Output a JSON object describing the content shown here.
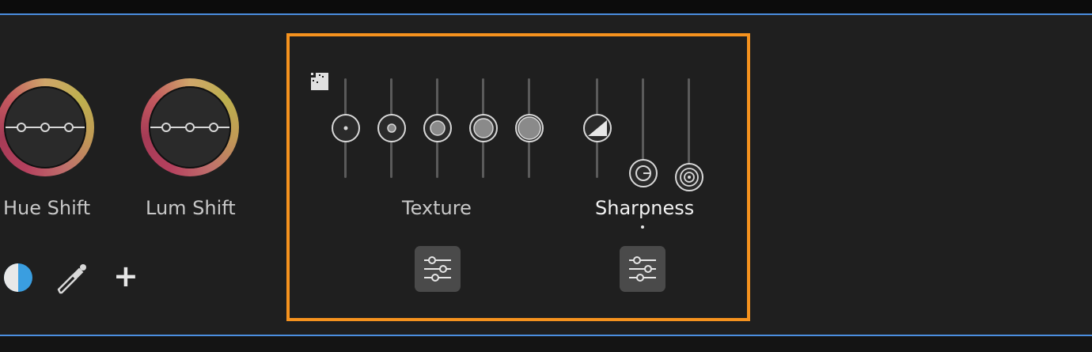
{
  "wheels": [
    {
      "label": "Hue Shift"
    },
    {
      "label": "Lum Shift"
    }
  ],
  "tools": {
    "split_icon": "half-circle-icon",
    "eyedropper_icon": "eyedropper-icon",
    "add_icon": "plus-icon",
    "add_glyph": "+"
  },
  "texture": {
    "label": "Texture",
    "slider_count": 5,
    "settings_icon": "sliders-icon"
  },
  "sharpness": {
    "label": "Sharpness",
    "settings_icon": "sliders-icon"
  },
  "colors": {
    "accent_blue": "#4b8ee0",
    "highlight_orange": "#f5921e",
    "split_blue": "#3a9ee0"
  }
}
